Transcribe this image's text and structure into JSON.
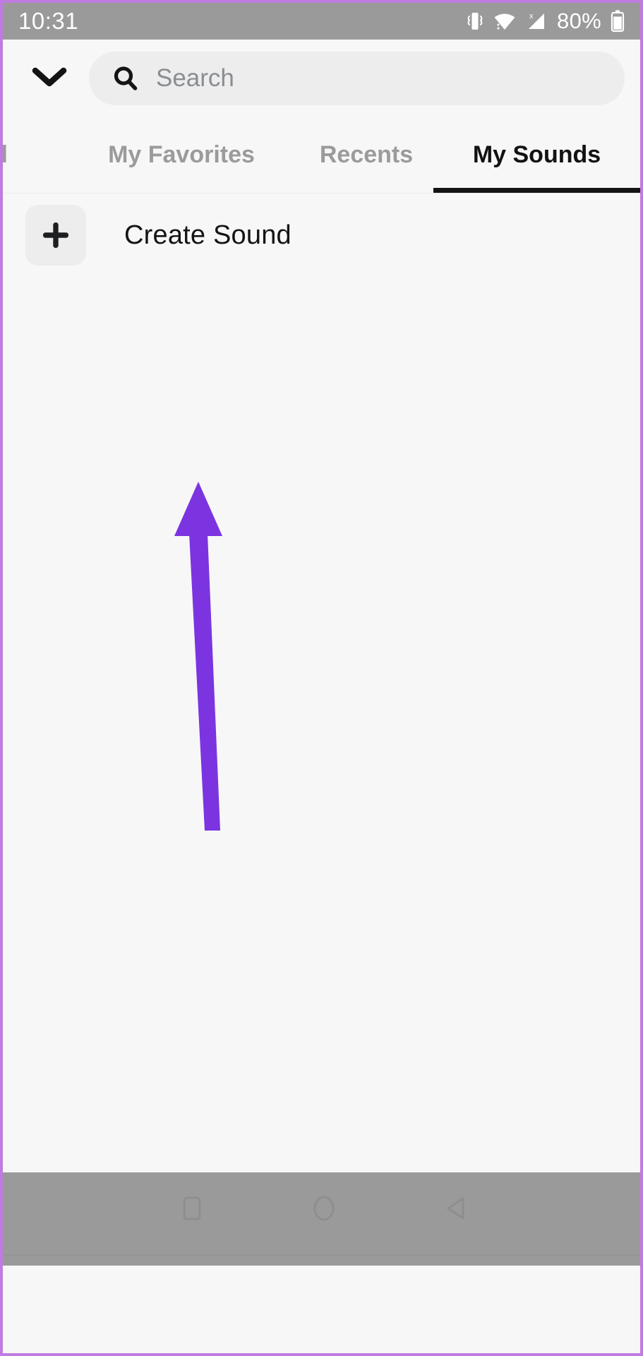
{
  "status_bar": {
    "time": "10:31",
    "battery_percent": "80%",
    "icons": [
      "vibrate-icon",
      "wifi-icon",
      "cellular-signal-no-sim-icon",
      "battery-icon"
    ],
    "background_color": "#9a9a9a",
    "text_color": "#ffffff"
  },
  "header": {
    "collapse_icon": "chevron-down-icon",
    "search": {
      "icon": "search-icon",
      "placeholder": "Search",
      "value": ""
    }
  },
  "tabs": {
    "items": [
      {
        "label": "red",
        "active": false,
        "truncated": true
      },
      {
        "label": "My Favorites",
        "active": false
      },
      {
        "label": "Recents",
        "active": false
      },
      {
        "label": "My Sounds",
        "active": true
      }
    ],
    "active_index": 3,
    "active_color": "#121212",
    "inactive_color": "#9b9b9b"
  },
  "content": {
    "rows": [
      {
        "icon": "plus-icon",
        "label": "Create Sound"
      }
    ]
  },
  "annotation": {
    "type": "arrow",
    "direction": "up",
    "color": "#7c34e0",
    "points_to": "Create Sound"
  },
  "nav_bar": {
    "buttons": [
      {
        "name": "recents-button",
        "icon": "square-icon"
      },
      {
        "name": "home-button",
        "icon": "circle-icon"
      },
      {
        "name": "back-button",
        "icon": "triangle-left-icon"
      }
    ],
    "background_color": "#9a9a9a"
  },
  "colors": {
    "app_background": "#f7f7f7",
    "chip_background": "#ededed",
    "frame_accent": "#c07be0",
    "annotation_purple": "#7c34e0"
  }
}
